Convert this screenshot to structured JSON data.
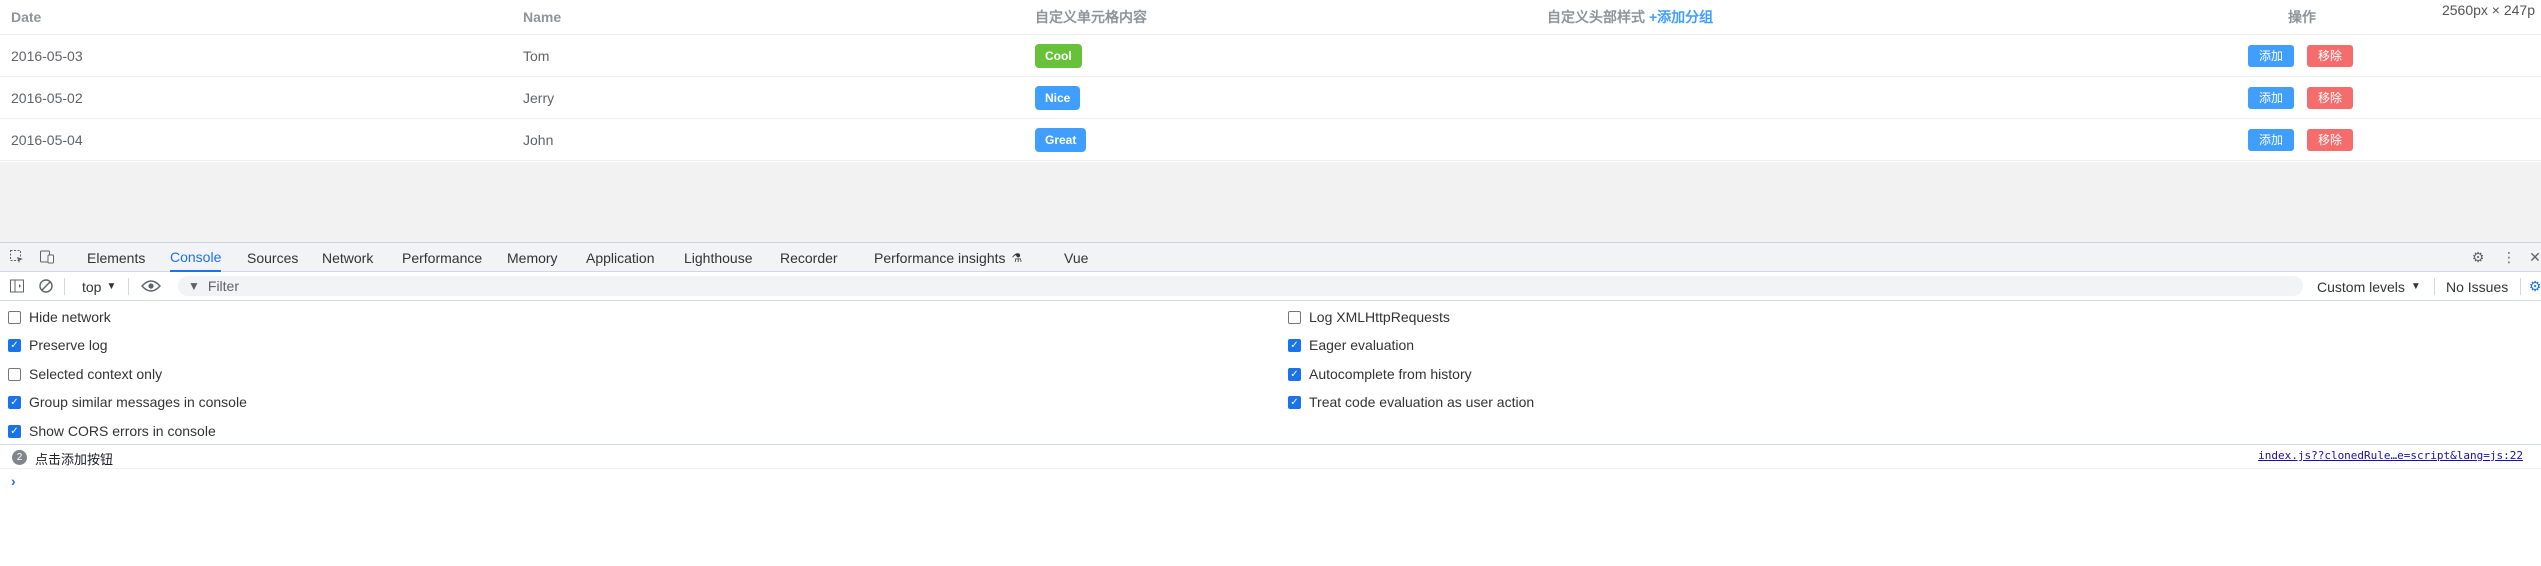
{
  "table": {
    "headers": {
      "date": "Date",
      "name": "Name",
      "custom_cell": "自定义单元格内容",
      "custom_header": "自定义头部样式",
      "add_group": "+添加分组",
      "ops": "操作"
    },
    "rows": [
      {
        "date": "2016-05-03",
        "name": "Tom",
        "tag": "Cool",
        "tag_color": "#67c23a",
        "add": "添加",
        "remove": "移除"
      },
      {
        "date": "2016-05-02",
        "name": "Jerry",
        "tag": "Nice",
        "tag_color": "#409eff",
        "add": "添加",
        "remove": "移除"
      },
      {
        "date": "2016-05-04",
        "name": "John",
        "tag": "Great",
        "tag_color": "#409eff",
        "add": "添加",
        "remove": "移除"
      }
    ],
    "viewport_size_readout": "2560px × 247p"
  },
  "devtools": {
    "tabs": [
      "Elements",
      "Console",
      "Sources",
      "Network",
      "Performance",
      "Memory",
      "Application",
      "Lighthouse",
      "Recorder",
      "Performance insights",
      "Vue"
    ],
    "active_tab": "Console",
    "toolbar": {
      "context": "top",
      "filter_placeholder": "Filter",
      "levels": "Custom levels",
      "issues": "No Issues"
    },
    "settings_left": [
      {
        "label": "Hide network",
        "checked": false
      },
      {
        "label": "Preserve log",
        "checked": true
      },
      {
        "label": "Selected context only",
        "checked": false
      },
      {
        "label": "Group similar messages in console",
        "checked": true
      },
      {
        "label": "Show CORS errors in console",
        "checked": true
      }
    ],
    "settings_right": [
      {
        "label": "Log XMLHttpRequests",
        "checked": false
      },
      {
        "label": "Eager evaluation",
        "checked": true
      },
      {
        "label": "Autocomplete from history",
        "checked": true
      },
      {
        "label": "Treat code evaluation as user action",
        "checked": true
      }
    ],
    "console_message": {
      "count": "2",
      "text": "点击添加按钮",
      "source": "index.js??clonedRule…e=script&lang=js:22"
    },
    "prompt_symbol": "›"
  },
  "colors": {
    "accent": "#409eff",
    "danger": "#f56c6c",
    "success": "#67c23a",
    "devtools_blue": "#1a73e8"
  }
}
